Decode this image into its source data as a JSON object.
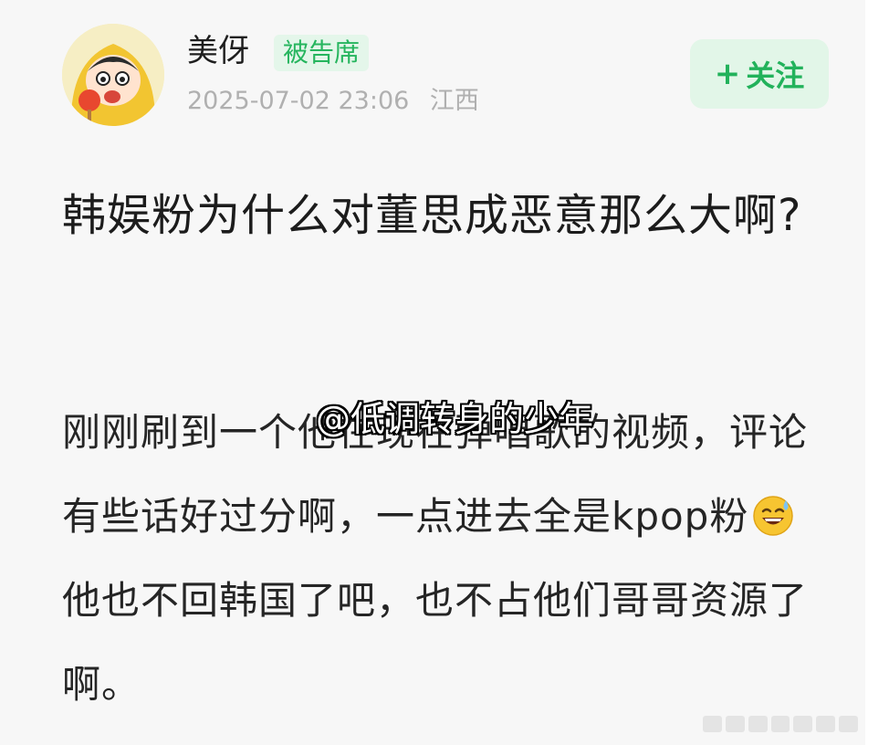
{
  "post": {
    "author": {
      "name": "美伢",
      "badge": "被告席",
      "timestamp": "2025-07-02 23:06",
      "location": "江西",
      "avatar_icon": "cartoon-avatar-icon"
    },
    "follow_button": {
      "plus": "+",
      "label": "关注"
    },
    "title": "韩娱粉为什么对董思成恶意那么大啊?",
    "body_part1": "刚刚刷到一个他在现在弹唱歌的视频，评论有些话好过分啊，一点进去全是kpop粉",
    "emoji_icon": "sweat-smile-emoji-icon",
    "body_part2": "他也不回韩国了吧，也不占他们哥哥资源了啊。"
  },
  "watermark": "@低调转身的少年",
  "colors": {
    "accent_green": "#22b25b",
    "badge_bg": "#e4f6ea",
    "meta_gray": "#b0b0b0"
  }
}
